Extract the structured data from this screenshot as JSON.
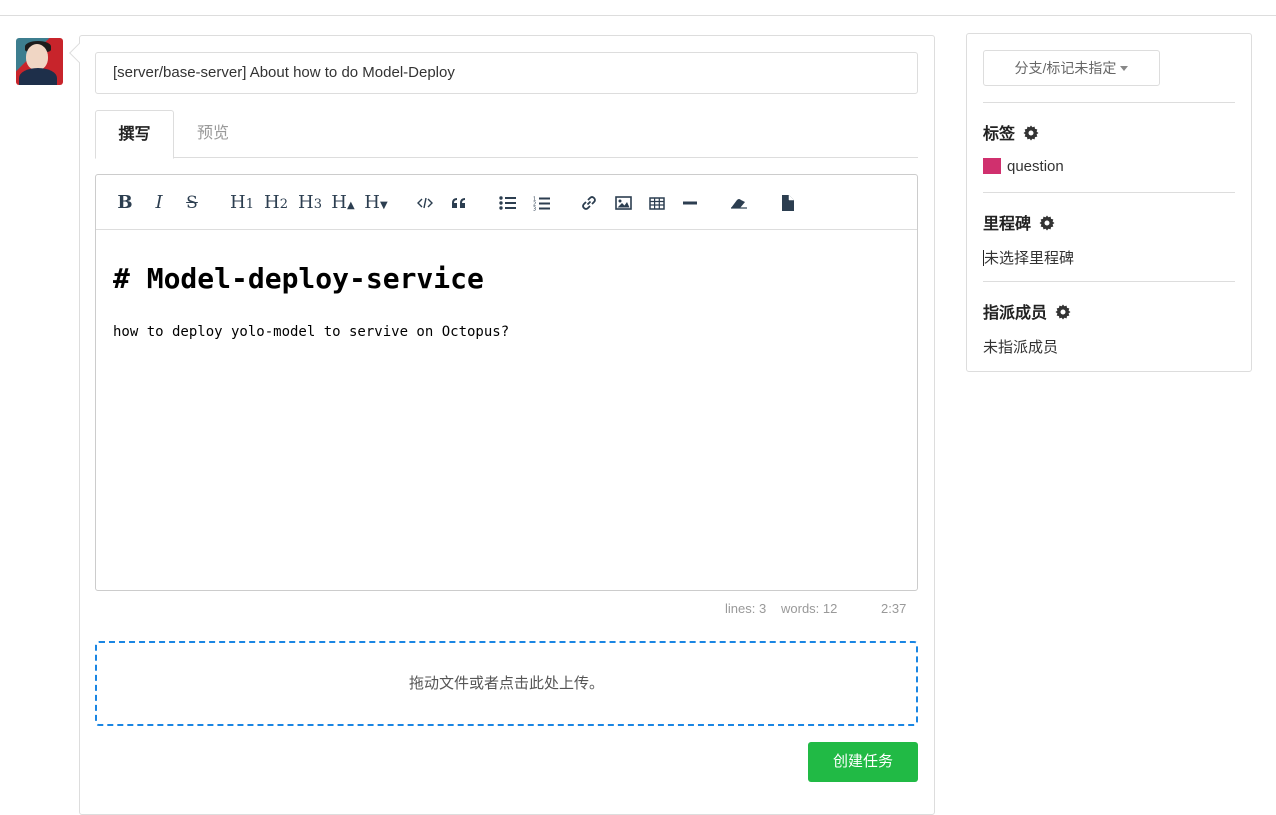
{
  "issue": {
    "title": "[server/base-server] About how to do Model-Deploy"
  },
  "tabs": [
    {
      "label": "撰写",
      "active": true
    },
    {
      "label": "预览",
      "active": false
    }
  ],
  "toolbar": {
    "bold": "B",
    "italic": "I",
    "strike": "S",
    "h1": "H",
    "h1_sub": "1",
    "h2": "H",
    "h2_sub": "2",
    "h3": "H",
    "h3_sub": "3",
    "h_bigger": "H",
    "h_smaller": "H",
    "icons": [
      "code-icon",
      "quote-icon",
      "unordered-list-icon",
      "ordered-list-icon",
      "link-icon",
      "image-icon",
      "table-icon",
      "horizontal-rule-icon",
      "eraser-icon",
      "file-icon"
    ]
  },
  "editor": {
    "heading": "# Model-deploy-service",
    "body": "how to deploy yolo-model to servive on Octopus?"
  },
  "status": {
    "lines": "lines: 3",
    "words": "words: 12",
    "cursor": "2:37"
  },
  "dropzone": {
    "text": "拖动文件或者点击此处上传。"
  },
  "create_button": "创建任务",
  "sidebar": {
    "branch_button": "分支/标记未指定",
    "labels": {
      "heading": "标签",
      "value": "question",
      "color": "#d0306e"
    },
    "milestone": {
      "heading": "里程碑",
      "value": "未选择里程碑"
    },
    "assignees": {
      "heading": "指派成员",
      "value": "未指派成员"
    }
  }
}
